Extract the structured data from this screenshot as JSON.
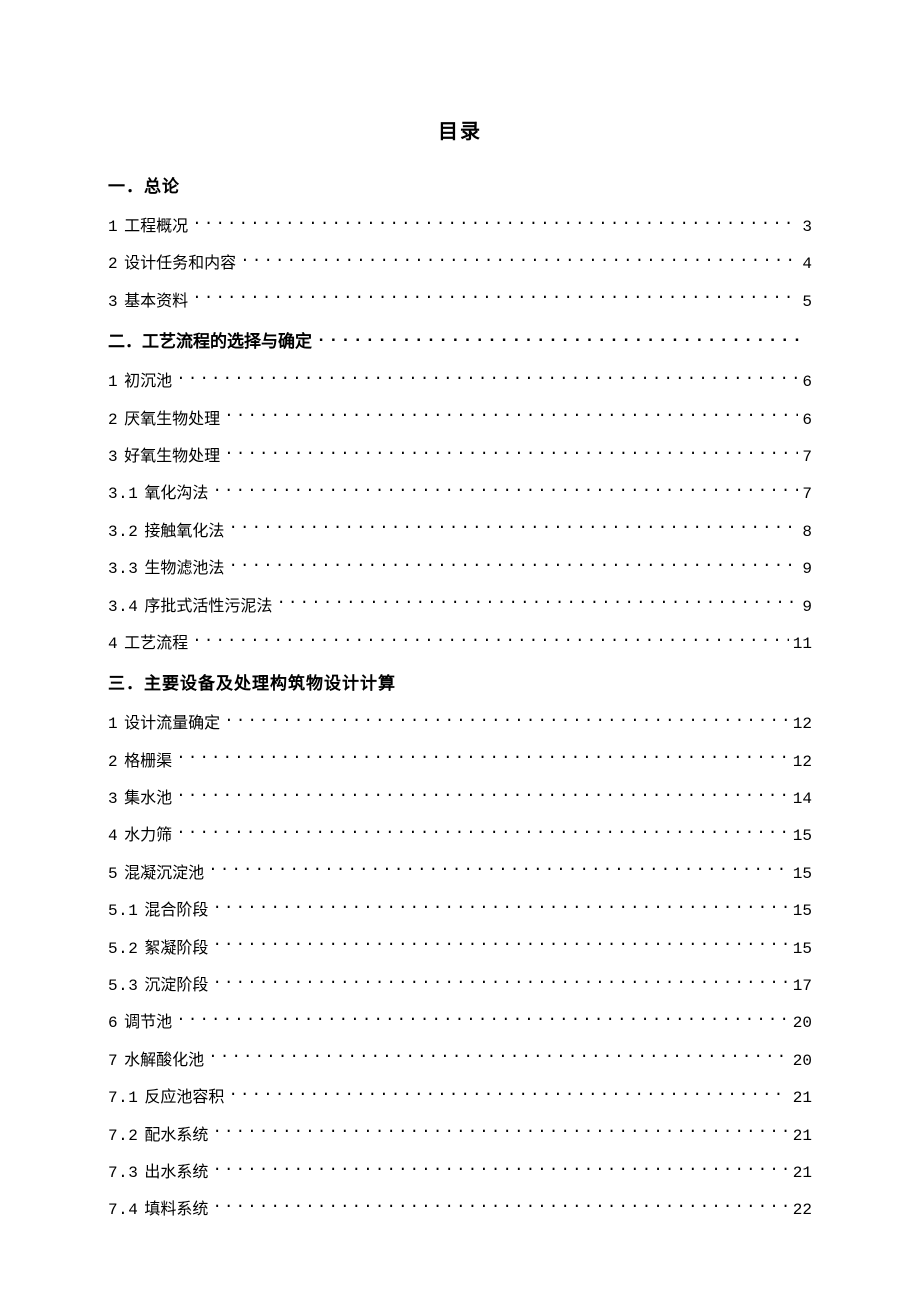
{
  "title": "目录",
  "sections": [
    {
      "heading": "一．总论",
      "has_leader": false,
      "page": "",
      "entries": [
        {
          "num": "1",
          "label": "工程概况",
          "page": "3"
        },
        {
          "num": "2",
          "label": "设计任务和内容",
          "page": "4"
        },
        {
          "num": "3",
          "label": "基本资料",
          "page": "5"
        }
      ]
    },
    {
      "heading": "二．工艺流程的选择与确定",
      "has_leader": true,
      "page": "",
      "entries": [
        {
          "num": "1",
          "label": "初沉池",
          "page": "6"
        },
        {
          "num": "2",
          "label": "厌氧生物处理",
          "page": "6"
        },
        {
          "num": "3",
          "label": "好氧生物处理",
          "page": "7"
        },
        {
          "num": "3.1",
          "label": "氧化沟法",
          "page": "7"
        },
        {
          "num": "3.2",
          "label": "接触氧化法",
          "page": "8"
        },
        {
          "num": "3.3",
          "label": "生物滤池法",
          "page": "9"
        },
        {
          "num": "3.4",
          "label": "序批式活性污泥法",
          "page": "9"
        },
        {
          "num": "4",
          "label": "工艺流程",
          "page": "11"
        }
      ]
    },
    {
      "heading": "三．主要设备及处理构筑物设计计算",
      "has_leader": false,
      "page": "",
      "entries": [
        {
          "num": "1",
          "label": "设计流量确定",
          "page": "12"
        },
        {
          "num": "2",
          "label": "格栅渠",
          "page": "12"
        },
        {
          "num": "3",
          "label": "集水池",
          "page": "14"
        },
        {
          "num": "4",
          "label": "水力筛",
          "page": "15"
        },
        {
          "num": "5",
          "label": "混凝沉淀池",
          "page": "15"
        },
        {
          "num": "5.1",
          "label": "混合阶段",
          "page": "15"
        },
        {
          "num": "5.2",
          "label": "絮凝阶段",
          "page": "15"
        },
        {
          "num": "5.3",
          "label": "沉淀阶段",
          "page": "17"
        },
        {
          "num": "6",
          "label": "调节池",
          "page": "20"
        },
        {
          "num": "7",
          "label": "水解酸化池",
          "page": "20"
        },
        {
          "num": "7.1",
          "label": "反应池容积",
          "page": "21"
        },
        {
          "num": "7.2",
          "label": "配水系统",
          "page": "21"
        },
        {
          "num": "7.3",
          "label": "出水系统",
          "page": "21"
        },
        {
          "num": "7.4",
          "label": "填料系统",
          "page": "22"
        }
      ]
    }
  ]
}
